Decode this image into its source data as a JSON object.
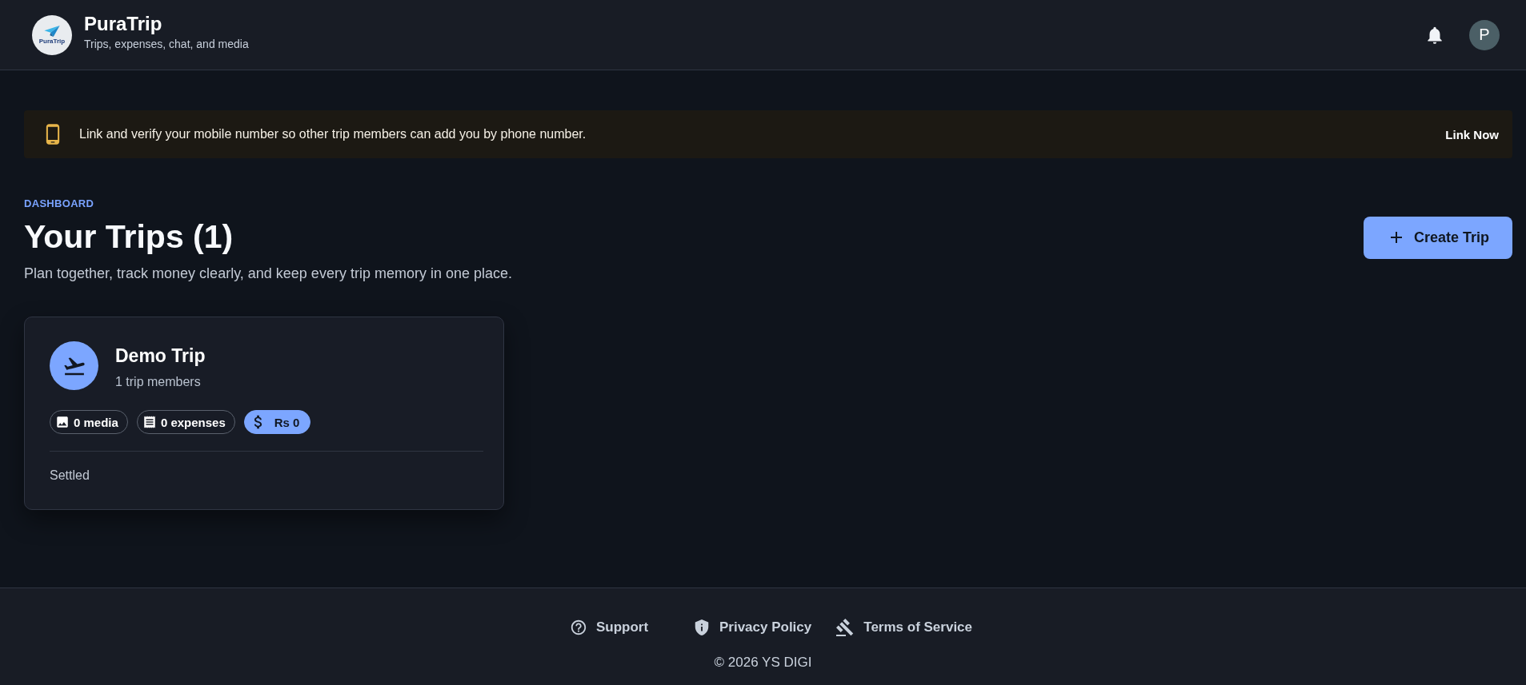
{
  "header": {
    "logo": {
      "text": "PuraTrip"
    },
    "title": "PuraTrip",
    "subtitle": "Trips, expenses, chat, and media",
    "avatar_initial": "P"
  },
  "banner": {
    "message": "Link and verify your mobile number so other trip members can add you by phone number.",
    "action": "Link Now"
  },
  "dashboard": {
    "eyebrow": "DASHBOARD",
    "title": "Your Trips (1)",
    "subtitle": "Plan together, track money clearly, and keep every trip memory in one place.",
    "create_button": "Create Trip"
  },
  "trips": [
    {
      "name": "Demo Trip",
      "members": "1 trip members",
      "stats": [
        {
          "kind": "media",
          "label": "0 media",
          "highlighted": false
        },
        {
          "kind": "expenses",
          "label": "0 expenses",
          "highlighted": false
        },
        {
          "kind": "balance",
          "label": "Rs 0",
          "highlighted": true
        }
      ],
      "status": "Settled"
    }
  ],
  "footer": {
    "links": [
      {
        "kind": "support",
        "label": "Support"
      },
      {
        "kind": "privacy",
        "label": "Privacy Policy"
      },
      {
        "kind": "terms",
        "label": "Terms of Service"
      }
    ],
    "copyright": "© 2026 YS DIGI"
  }
}
